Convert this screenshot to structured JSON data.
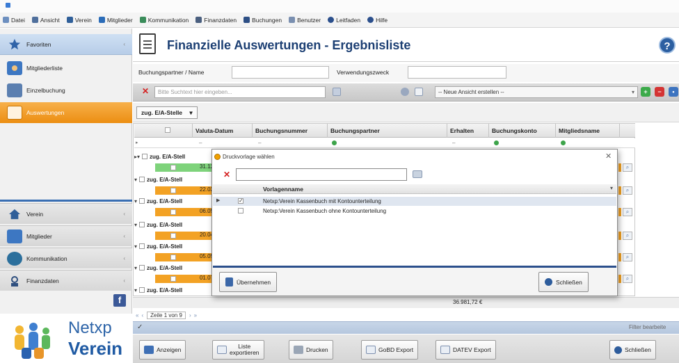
{
  "menu": [
    {
      "label": "Datei",
      "icon": "file-icon",
      "color": "#6d8fbf"
    },
    {
      "label": "Ansicht",
      "icon": "view-icon",
      "color": "#4f6f9c"
    },
    {
      "label": "Verein",
      "icon": "home-icon",
      "color": "#2f5f99"
    },
    {
      "label": "Mitglieder",
      "icon": "members-icon",
      "color": "#2b6cb8"
    },
    {
      "label": "Kommunikation",
      "icon": "communication-icon",
      "color": "#3a8c5a"
    },
    {
      "label": "Finanzdaten",
      "icon": "finance-icon",
      "color": "#4a5f7f"
    },
    {
      "label": "Buchungen",
      "icon": "bookings-icon",
      "color": "#2d4f85"
    },
    {
      "label": "Benutzer",
      "icon": "user-icon",
      "color": "#7a8fb0"
    },
    {
      "label": "Leitfaden",
      "icon": "guide-icon",
      "color": "#2b4f8c"
    },
    {
      "label": "Hilfe",
      "icon": "help-icon",
      "color": "#2b4f8c"
    }
  ],
  "nav": {
    "favorites": "Favoriten",
    "items": [
      "Mitgliederliste",
      "Einzelbuchung",
      "Auswertungen"
    ],
    "groups": [
      "Verein",
      "Mitglieder",
      "Kommunikation",
      "Finanzdaten"
    ]
  },
  "logo": {
    "line1": "Netxp",
    "line2": "Verein"
  },
  "header": {
    "title": "Finanzielle Auswertungen - Ergebnisliste",
    "help": "?"
  },
  "filters": {
    "partner_label": "Buchungspartner / Name",
    "purpose_label": "Verwendungszweck"
  },
  "search": {
    "placeholder": "Bitte Suchtext hier eingeben...",
    "view_select": "-- Neue Ansicht erstellen --"
  },
  "grouping": {
    "chip": "zug. E/A-Stelle"
  },
  "grid": {
    "columns": [
      "Valuta-Datum",
      "Buchungsnummer",
      "Buchungspartner",
      "Erhalten",
      "Buchungskonto",
      "Mitgliedsname"
    ],
    "group_label": "zug. E/A-Stell",
    "dates": [
      "31.12",
      "22.03",
      "06.05",
      "20.04",
      "05.05",
      "01.07"
    ]
  },
  "totals": {
    "value": "36.981,72 €"
  },
  "pager": {
    "label": "Zeile 1 von 9"
  },
  "status": {
    "right": "Filter bearbeite"
  },
  "buttons": {
    "show": "Anzeigen",
    "export_line1": "Liste",
    "export_line2": "exportieren",
    "print": "Drucken",
    "gobd": "GoBD Export",
    "datev": "DATEV Export",
    "close": "Schließen"
  },
  "dialog": {
    "title": "Druckvorlage wählen",
    "column": "Vorlagenname",
    "rows": [
      {
        "name": "Netxp:Verein Kassenbuch mit Kontounterteilung",
        "checked": "✓"
      },
      {
        "name": "Netxp:Verein Kassenbuch ohne Kontounterteilung",
        "checked": ""
      }
    ],
    "accept": "Übernehmen",
    "close": "Schließen"
  },
  "colors": {
    "accent": "#2b4f8c",
    "active_nav": "#ec8e12",
    "row_orange": "#f3a224",
    "row_green": "#7ed37b"
  }
}
